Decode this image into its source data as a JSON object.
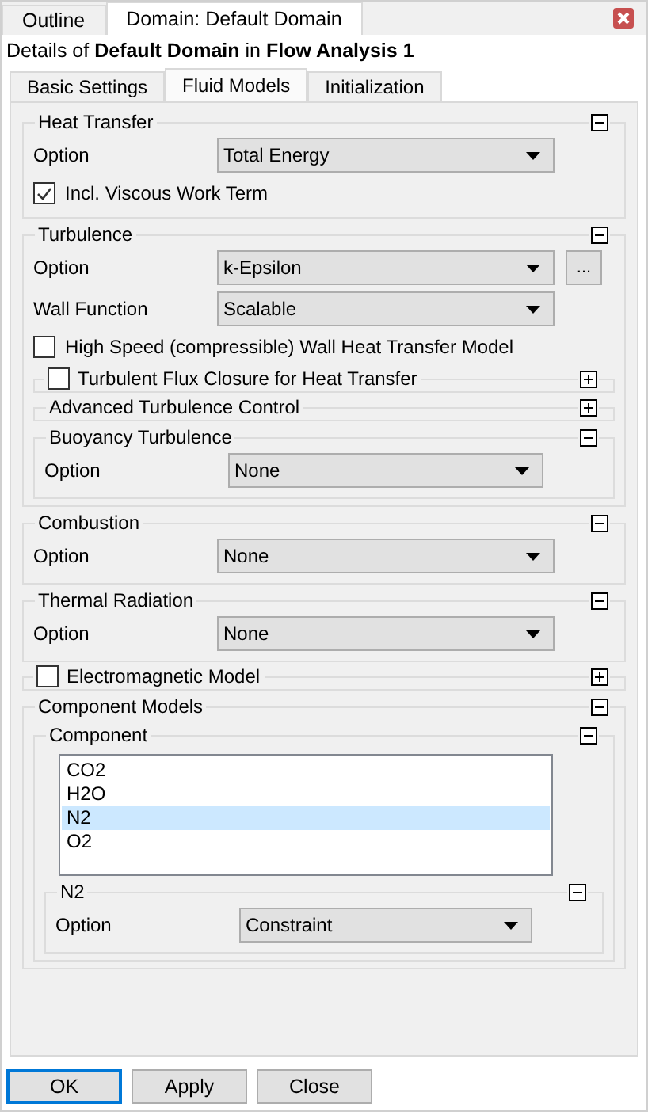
{
  "window_tabs": [
    {
      "label": "Outline",
      "selected": false
    },
    {
      "label": "Domain: Default Domain",
      "selected": true
    }
  ],
  "details_title": "Details of **Default Domain** in **Flow Analysis 1**",
  "tabs": [
    {
      "label": "Basic Settings",
      "selected": false
    },
    {
      "label": "Fluid Models",
      "selected": true
    },
    {
      "label": "Initialization",
      "selected": false
    }
  ],
  "sections": [
    {
      "kind": "group",
      "title": "Heat Transfer",
      "expanded": true,
      "items": [
        {
          "kind": "dropdown",
          "label": "Option",
          "value": "Total Energy"
        },
        {
          "kind": "checkbox",
          "label": "Incl. Viscous Work Term",
          "checked": true
        }
      ]
    },
    {
      "kind": "group",
      "title": "Turbulence",
      "expanded": true,
      "items": [
        {
          "kind": "dropdown",
          "label": "Option",
          "value": "k-Epsilon",
          "button": "..."
        },
        {
          "kind": "dropdown",
          "label": "Wall Function",
          "value": "Scalable"
        },
        {
          "kind": "checkbox",
          "label": "High Speed (compressible) Wall Heat Transfer Model",
          "checked": false
        },
        {
          "kind": "group",
          "title": "Turbulent Flux Closure for Heat Transfer",
          "checked": false,
          "expanded": false
        },
        {
          "kind": "group",
          "title": "Advanced Turbulence Control",
          "expanded": false
        },
        {
          "kind": "group",
          "title": "Buoyancy Turbulence",
          "expanded": true,
          "items": [
            {
              "kind": "dropdown",
              "label": "Option",
              "value": "None"
            }
          ]
        }
      ]
    },
    {
      "kind": "group",
      "title": "Combustion",
      "expanded": true,
      "items": [
        {
          "kind": "dropdown",
          "label": "Option",
          "value": "None"
        }
      ]
    },
    {
      "kind": "group",
      "title": "Thermal Radiation",
      "expanded": true,
      "items": [
        {
          "kind": "dropdown",
          "label": "Option",
          "value": "None"
        }
      ]
    },
    {
      "kind": "group",
      "title": "Electromagnetic Model",
      "checked": false,
      "expanded": false
    },
    {
      "kind": "group",
      "title": "Component Models",
      "expanded": true,
      "items": [
        {
          "kind": "group",
          "title": "Component",
          "expanded": true,
          "items": [
            {
              "kind": "list",
              "entries": [
                {
                  "label": "CO2",
                  "selected": false
                },
                {
                  "label": "H2O",
                  "selected": false
                },
                {
                  "label": "N2",
                  "selected": true
                },
                {
                  "label": "O2",
                  "selected": false
                }
              ]
            },
            {
              "kind": "group",
              "title": "N2",
              "expanded": true,
              "items": [
                {
                  "kind": "dropdown",
                  "label": "Option",
                  "value": "Constraint"
                }
              ]
            }
          ]
        }
      ]
    }
  ],
  "buttons": [
    {
      "label": "OK",
      "selected": true
    },
    {
      "label": "Apply",
      "selected": false
    },
    {
      "label": "Close",
      "selected": false
    }
  ]
}
